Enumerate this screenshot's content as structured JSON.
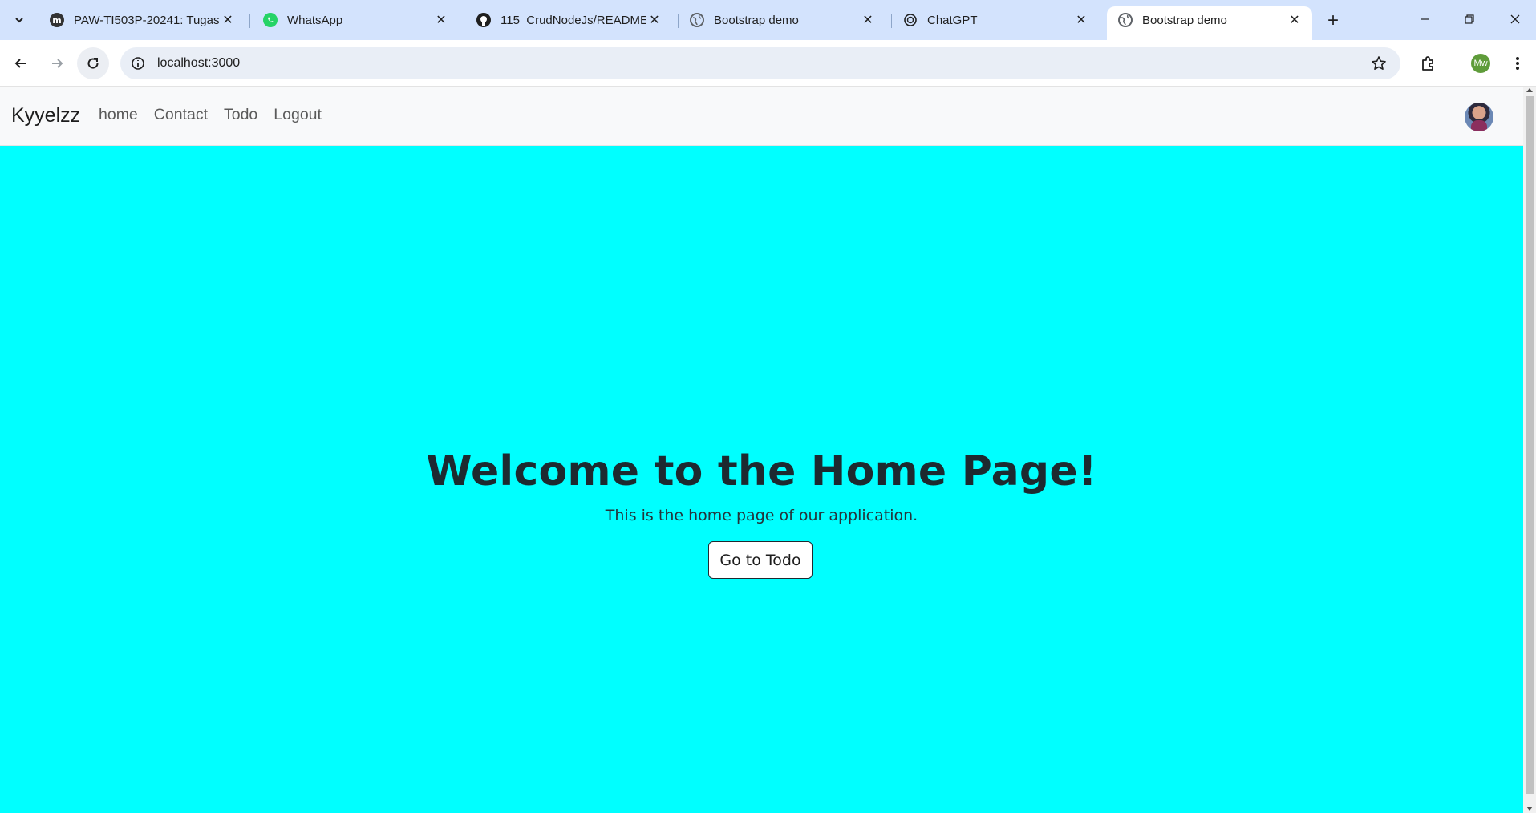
{
  "browser": {
    "tabs": [
      {
        "title": "PAW-TI503P-20241: Tugas",
        "icon": "moodle-icon"
      },
      {
        "title": "WhatsApp",
        "icon": "whatsapp-icon"
      },
      {
        "title": "115_CrudNodeJs/README",
        "icon": "github-icon"
      },
      {
        "title": "Bootstrap demo",
        "icon": "globe-icon"
      },
      {
        "title": "ChatGPT",
        "icon": "chatgpt-icon"
      },
      {
        "title": "Bootstrap demo",
        "icon": "globe-icon",
        "active": true
      }
    ],
    "url": "localhost:3000",
    "profile_initials": "Mw",
    "accent": "#d3e3fd"
  },
  "page": {
    "background": "#00ffff",
    "navbar": {
      "brand": "Kyyelzz",
      "links": [
        "home",
        "Contact",
        "Todo",
        "Logout"
      ]
    },
    "hero": {
      "heading": "Welcome to the Home Page!",
      "subtext": "This is the home page of our application.",
      "button_label": "Go to Todo"
    }
  }
}
